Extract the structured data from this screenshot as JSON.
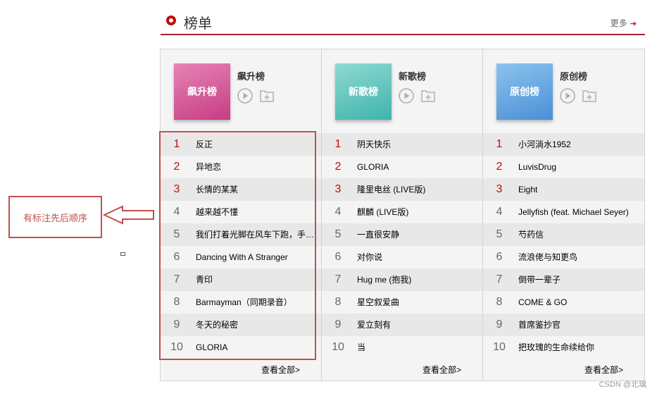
{
  "header": {
    "title": "榜单",
    "more_label": "更多",
    "more_arrow": "➔"
  },
  "boards": [
    {
      "cover_text": "飙升榜",
      "name": "飙升榜",
      "songs": [
        {
          "rank": "1",
          "title": "反正"
        },
        {
          "rank": "2",
          "title": "异地恋"
        },
        {
          "rank": "3",
          "title": "长情的某某"
        },
        {
          "rank": "4",
          "title": "越来越不懂"
        },
        {
          "rank": "5",
          "title": "我们打着光脚在风车下跑，手…"
        },
        {
          "rank": "6",
          "title": "Dancing With A Stranger"
        },
        {
          "rank": "7",
          "title": "青印"
        },
        {
          "rank": "8",
          "title": "Barmayman（同期录音）"
        },
        {
          "rank": "9",
          "title": "冬天的秘密"
        },
        {
          "rank": "10",
          "title": "GLORIA"
        }
      ],
      "see_all": "查看全部>"
    },
    {
      "cover_text": "新歌榜",
      "name": "新歌榜",
      "songs": [
        {
          "rank": "1",
          "title": "阴天快乐"
        },
        {
          "rank": "2",
          "title": "GLORIA"
        },
        {
          "rank": "3",
          "title": "隆里电丝 (LIVE版)"
        },
        {
          "rank": "4",
          "title": "麒麟 (LIVE版)"
        },
        {
          "rank": "5",
          "title": "一直很安静"
        },
        {
          "rank": "6",
          "title": "对你说"
        },
        {
          "rank": "7",
          "title": "Hug me (抱我)"
        },
        {
          "rank": "8",
          "title": "星空叙爱曲"
        },
        {
          "rank": "9",
          "title": "爱立刻有"
        },
        {
          "rank": "10",
          "title": "当"
        }
      ],
      "see_all": "查看全部>"
    },
    {
      "cover_text": "原创榜",
      "name": "原创榜",
      "songs": [
        {
          "rank": "1",
          "title": "小河淌水1952"
        },
        {
          "rank": "2",
          "title": "LuvisDrug"
        },
        {
          "rank": "3",
          "title": "Eight"
        },
        {
          "rank": "4",
          "title": "Jellyfish (feat. Michael Seyer)"
        },
        {
          "rank": "5",
          "title": "芍药信"
        },
        {
          "rank": "6",
          "title": "流浪佬与知更鸟"
        },
        {
          "rank": "7",
          "title": "倒带一辈子"
        },
        {
          "rank": "8",
          "title": "COME & GO"
        },
        {
          "rank": "9",
          "title": "首席鉴抄官"
        },
        {
          "rank": "10",
          "title": "把玫瑰的生命续给你"
        }
      ],
      "see_all": "查看全部>"
    }
  ],
  "annotation": {
    "note": "有标注先后顺序"
  },
  "watermark": "CSDN @北璃",
  "colors": {
    "accent": "#c20c0c",
    "rank_top": "#c10d0c",
    "annotation": "#c0504d"
  },
  "icons": {
    "play": "play-circle-icon",
    "add": "add-to-playlist-icon",
    "more": "arrow-right-icon"
  }
}
